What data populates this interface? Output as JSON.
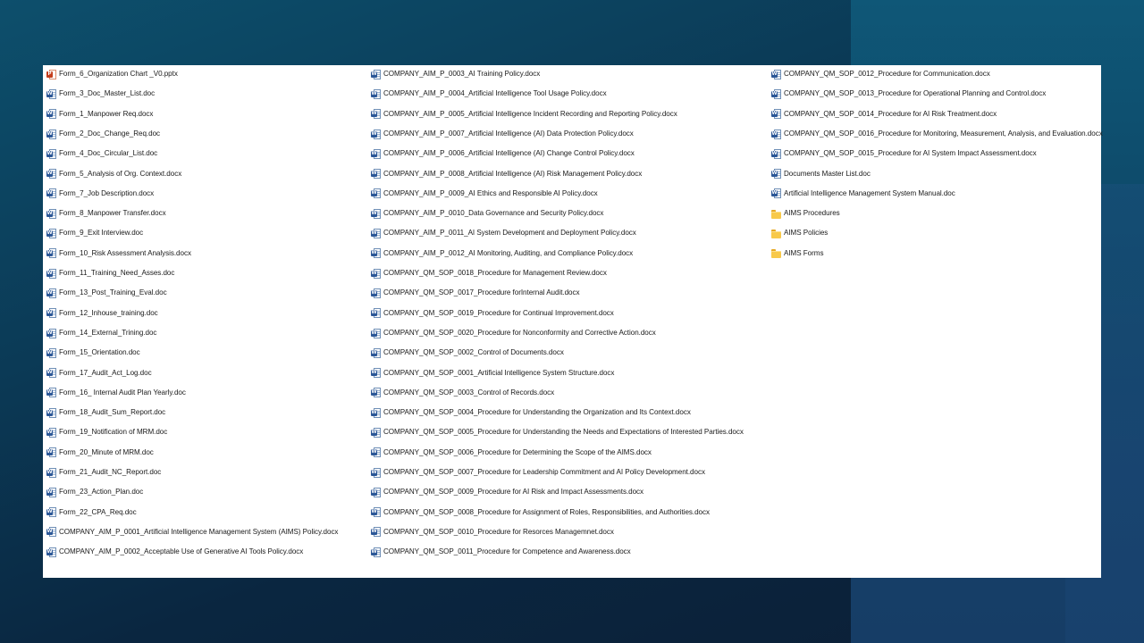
{
  "file_list": {
    "columns": [
      [
        {
          "name": "Form_6_Organization Chart _V0.pptx",
          "type": "ppt"
        },
        {
          "name": "Form_3_Doc_Master_List.doc",
          "type": "doc"
        },
        {
          "name": "Form_1_Manpower Req.docx",
          "type": "doc"
        },
        {
          "name": "Form_2_Doc_Change_Req.doc",
          "type": "doc"
        },
        {
          "name": "Form_4_Doc_Circular_List.doc",
          "type": "doc"
        },
        {
          "name": "Form_5_Analysis of Org. Context.docx",
          "type": "doc"
        },
        {
          "name": "Form_7_Job Description.docx",
          "type": "doc"
        },
        {
          "name": "Form_8_Manpower Transfer.docx",
          "type": "doc"
        },
        {
          "name": "Form_9_Exit Interview.doc",
          "type": "doc"
        },
        {
          "name": "Form_10_Risk Assessment Analysis.docx",
          "type": "doc"
        },
        {
          "name": "Form_11_Training_Need_Asses.doc",
          "type": "doc"
        },
        {
          "name": "Form_13_Post_Training_Eval.doc",
          "type": "doc"
        },
        {
          "name": "Form_12_Inhouse_training.doc",
          "type": "doc"
        },
        {
          "name": "Form_14_External_Trining.doc",
          "type": "doc"
        },
        {
          "name": "Form_15_Orientation.doc",
          "type": "doc"
        },
        {
          "name": "Form_17_Audit_Act_Log.doc",
          "type": "doc"
        },
        {
          "name": "Form_16_ Internal Audit Plan Yearly.doc",
          "type": "doc"
        },
        {
          "name": "Form_18_Audit_Sum_Report.doc",
          "type": "doc"
        },
        {
          "name": "Form_19_Notification of MRM.doc",
          "type": "doc"
        },
        {
          "name": "Form_20_Minute of MRM.doc",
          "type": "doc"
        },
        {
          "name": "Form_21_Audit_NC_Report.doc",
          "type": "doc"
        },
        {
          "name": "Form_23_Action_Plan.doc",
          "type": "doc"
        },
        {
          "name": "Form_22_CPA_Req.doc",
          "type": "doc"
        },
        {
          "name": "COMPANY_AIM_P_0001_Artificial Intelligence Management System (AIMS) Policy.docx",
          "type": "doc"
        },
        {
          "name": "COMPANY_AIM_P_0002_Acceptable Use of Generative AI Tools Policy.docx",
          "type": "doc"
        }
      ],
      [
        {
          "name": "COMPANY_AIM_P_0003_AI Training Policy.docx",
          "type": "doc"
        },
        {
          "name": "COMPANY_AIM_P_0004_Artificial Intelligence Tool Usage Policy.docx",
          "type": "doc"
        },
        {
          "name": "COMPANY_AIM_P_0005_Artificial Intelligence Incident Recording and Reporting Policy.docx",
          "type": "doc"
        },
        {
          "name": "COMPANY_AIM_P_0007_Artificial Intelligence (AI) Data Protection Policy.docx",
          "type": "doc"
        },
        {
          "name": "COMPANY_AIM_P_0006_Artificial Intelligence (AI) Change Control Policy.docx",
          "type": "doc"
        },
        {
          "name": "COMPANY_AIM_P_0008_Artificial Intelligence (AI) Risk Management Policy.docx",
          "type": "doc"
        },
        {
          "name": "COMPANY_AIM_P_0009_AI Ethics and Responsible AI Policy.docx",
          "type": "doc"
        },
        {
          "name": "COMPANY_AIM_P_0010_Data Governance and Security Policy.docx",
          "type": "doc"
        },
        {
          "name": "COMPANY_AIM_P_0011_AI System Development and Deployment Policy.docx",
          "type": "doc"
        },
        {
          "name": "COMPANY_AIM_P_0012_AI Monitoring, Auditing, and Compliance Policy.docx",
          "type": "doc"
        },
        {
          "name": "COMPANY_QM_SOP_0018_Procedure for Management Review.docx",
          "type": "doc"
        },
        {
          "name": "COMPANY_QM_SOP_0017_Procedure forInternal Audit.docx",
          "type": "doc"
        },
        {
          "name": "COMPANY_QM_SOP_0019_Procedure for Continual Improvement.docx",
          "type": "doc"
        },
        {
          "name": "COMPANY_QM_SOP_0020_Procedure for Nonconformity and Corrective Action.docx",
          "type": "doc"
        },
        {
          "name": "COMPANY_QM_SOP_0002_Control of Documents.docx",
          "type": "doc"
        },
        {
          "name": "COMPANY_QM_SOP_0001_Artificial Intelligence System Structure.docx",
          "type": "doc"
        },
        {
          "name": "COMPANY_QM_SOP_0003_Control of Records.docx",
          "type": "doc"
        },
        {
          "name": "COMPANY_QM_SOP_0004_Procedure for Understanding the Organization and Its Context.docx",
          "type": "doc"
        },
        {
          "name": "COMPANY_QM_SOP_0005_Procedure for Understanding the Needs and Expectations of Interested Parties.docx",
          "type": "doc"
        },
        {
          "name": "COMPANY_QM_SOP_0006_Procedure for Determining the Scope of the AIMS.docx",
          "type": "doc"
        },
        {
          "name": "COMPANY_QM_SOP_0007_Procedure for Leadership Commitment and AI Policy Development.docx",
          "type": "doc"
        },
        {
          "name": "COMPANY_QM_SOP_0009_Procedure for AI Risk and Impact Assessments.docx",
          "type": "doc"
        },
        {
          "name": "COMPANY_QM_SOP_0008_Procedure for Assignment of Roles, Responsibilities, and Authorities.docx",
          "type": "doc"
        },
        {
          "name": "COMPANY_QM_SOP_0010_Procedure for Resorces Managemnet.docx",
          "type": "doc"
        },
        {
          "name": "COMPANY_QM_SOP_0011_Procedure for Competence and Awareness.docx",
          "type": "doc"
        }
      ],
      [
        {
          "name": "COMPANY_QM_SOP_0012_Procedure for Communication.docx",
          "type": "doc"
        },
        {
          "name": "COMPANY_QM_SOP_0013_Procedure for Operational Planning and Control.docx",
          "type": "doc"
        },
        {
          "name": "COMPANY_QM_SOP_0014_Procedure for AI Risk Treatment.docx",
          "type": "doc"
        },
        {
          "name": "COMPANY_QM_SOP_0016_Procedure for Monitoring, Measurement, Analysis, and Evaluation.docx",
          "type": "doc"
        },
        {
          "name": "COMPANY_QM_SOP_0015_Procedure for AI System Impact Assessment.docx",
          "type": "doc"
        },
        {
          "name": "Documents Master List.doc",
          "type": "doc"
        },
        {
          "name": "Artificial Intelligence Management System Manual.doc",
          "type": "doc"
        },
        {
          "name": "AIMS Procedures",
          "type": "folder"
        },
        {
          "name": "AIMS Policies",
          "type": "folder"
        },
        {
          "name": "AIMS Forms",
          "type": "folder"
        }
      ]
    ]
  },
  "icons": {
    "doc": "word-document-icon",
    "ppt": "powerpoint-document-icon",
    "folder": "folder-icon"
  },
  "colors": {
    "word_blue": "#2b5797",
    "powerpoint_orange": "#c43e1c",
    "folder_yellow": "#f8c94a"
  }
}
